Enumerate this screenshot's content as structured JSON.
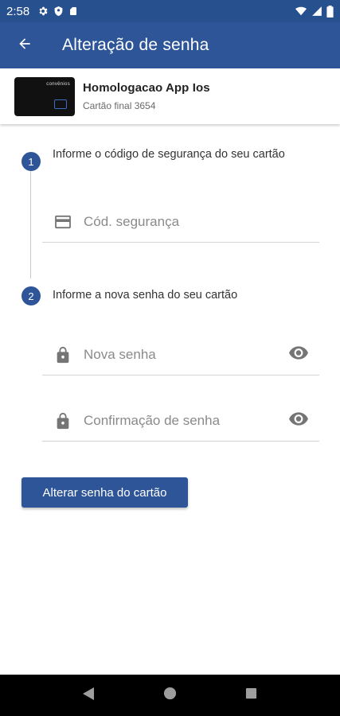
{
  "status_bar": {
    "time": "2:58"
  },
  "app_bar": {
    "title": "Alteração de senha",
    "back_icon": "arrow-back-icon"
  },
  "card": {
    "name": "Homologacao App Ios",
    "subtitle": "Cartão final 3654",
    "brand_text": "convênios"
  },
  "steps": [
    {
      "number": "1",
      "text": "Informe o código de segurança do seu cartão",
      "fields": [
        {
          "placeholder": "Cód. segurança",
          "icon": "credit-card-icon",
          "value": ""
        }
      ]
    },
    {
      "number": "2",
      "text": "Informe a nova senha do seu cartão",
      "fields": [
        {
          "placeholder": "Nova senha",
          "icon": "lock-icon",
          "value": "",
          "toggle_icon": "eye-icon"
        },
        {
          "placeholder": "Confirmação de senha",
          "icon": "lock-icon",
          "value": "",
          "toggle_icon": "eye-icon"
        }
      ]
    }
  ],
  "submit_label": "Alterar senha do cartão",
  "colors": {
    "primary": "#2e5597",
    "status_bar": "#27508e",
    "icon_gray": "#757575"
  }
}
